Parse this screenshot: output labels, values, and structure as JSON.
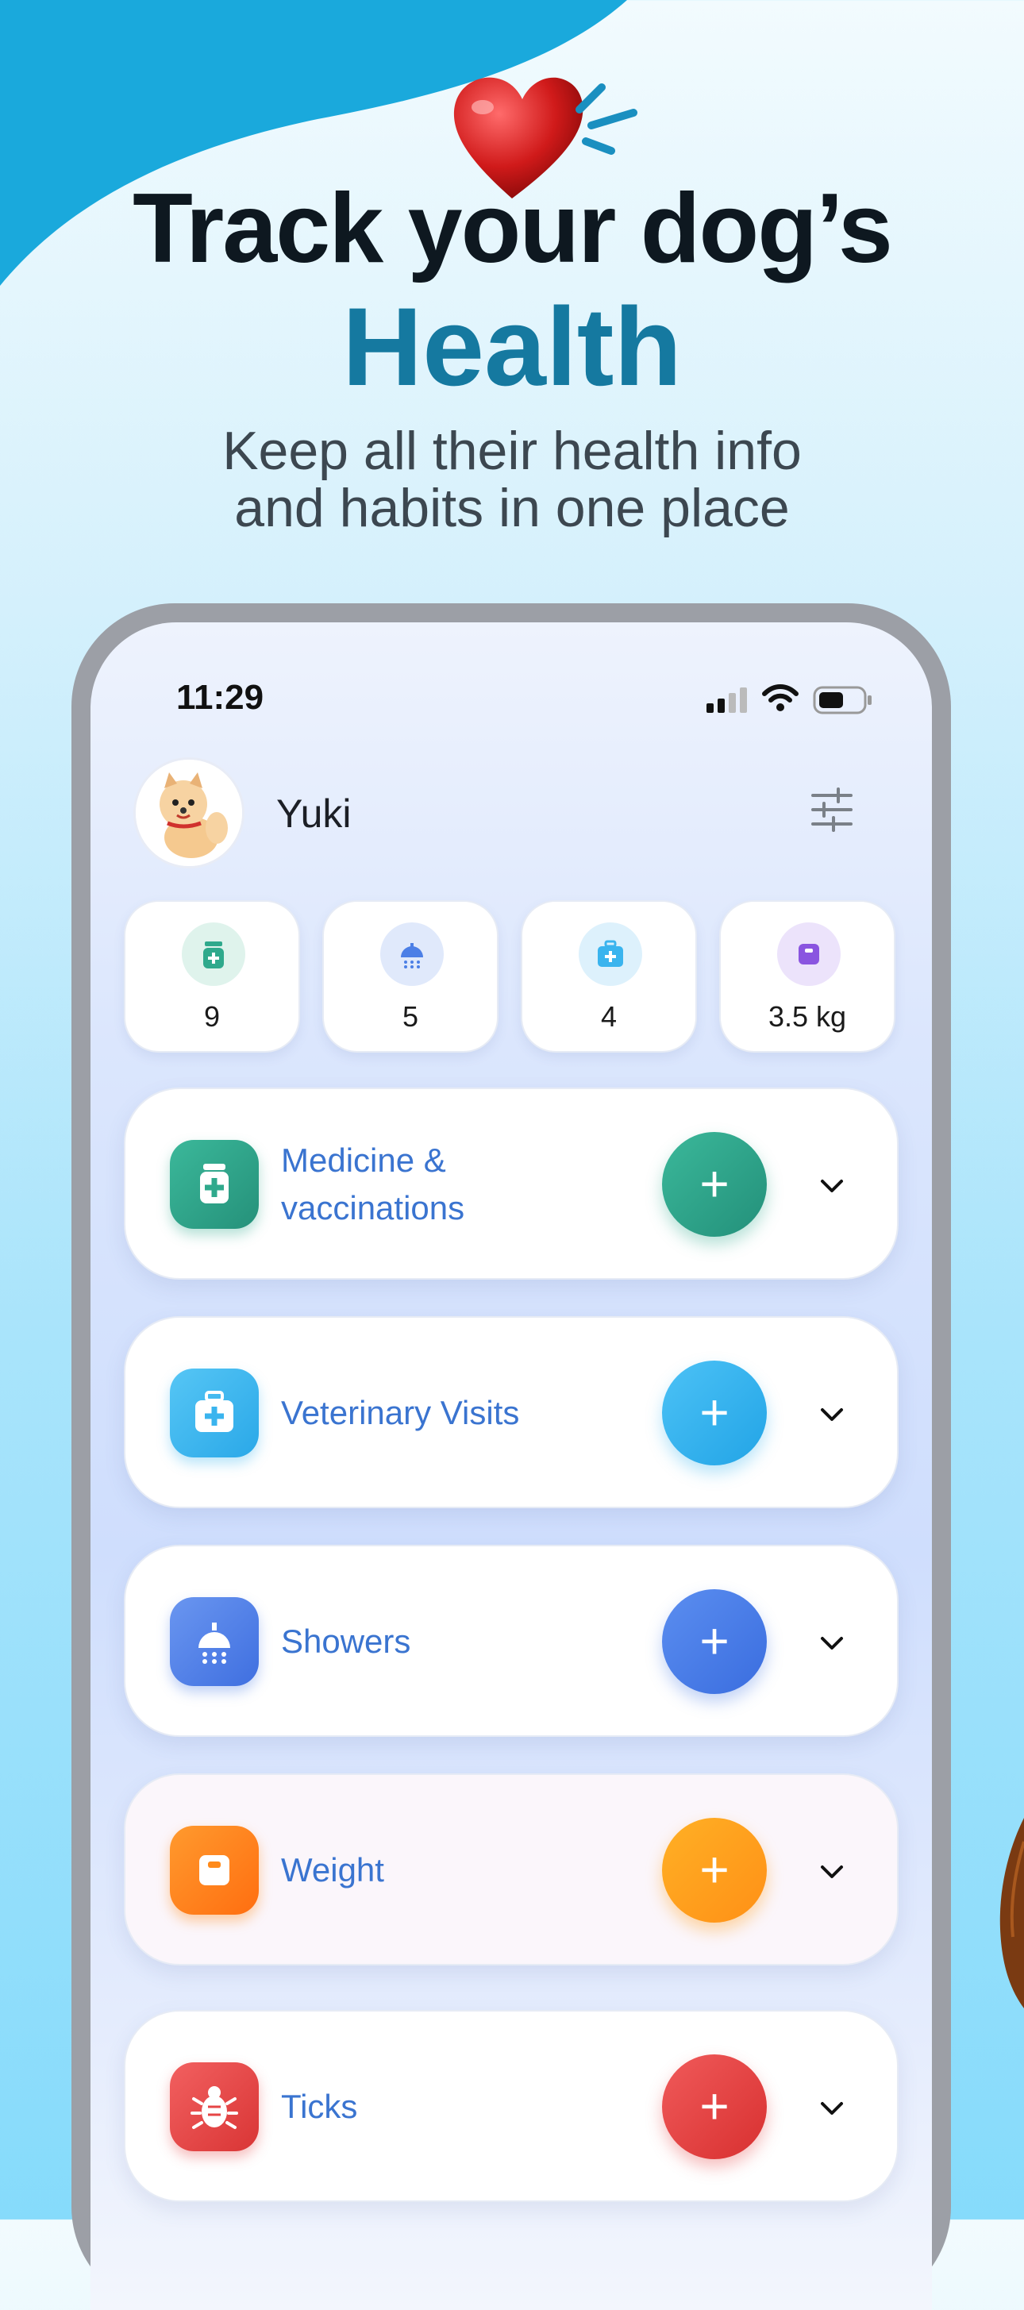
{
  "headline": {
    "line1": "Track your dog’s",
    "line2": "Health",
    "subtitle_line1": "Keep all their health info",
    "subtitle_line2": "and habits in one place"
  },
  "status_bar": {
    "time": "11:29"
  },
  "profile": {
    "pet_name": "Yuki",
    "avatar_icon": "pomeranian-avatar",
    "settings_icon": "sliders-icon"
  },
  "stats": [
    {
      "icon": "medicine-bottle-icon",
      "value": "9",
      "color": "#2fa98c"
    },
    {
      "icon": "shower-icon",
      "value": "5",
      "color": "#4c7fe6"
    },
    {
      "icon": "vet-kit-icon",
      "value": "4",
      "color": "#3ab4ee"
    },
    {
      "icon": "scale-icon",
      "value": "3.5 kg",
      "color": "#8a55e0"
    }
  ],
  "categories": [
    {
      "line1": "Medicine &",
      "line2": "vaccinations",
      "icon": "medicine-bottle-icon",
      "color": "#2fa98c"
    },
    {
      "line1": "Veterinary Visits",
      "icon": "vet-kit-icon",
      "color": "#3ab4ee"
    },
    {
      "line1": "Showers",
      "icon": "shower-icon",
      "color": "#4c7fe6"
    },
    {
      "line1": "Weight",
      "icon": "scale-icon",
      "color": "#ff8a1a"
    },
    {
      "line1": "Ticks",
      "icon": "tick-bug-icon",
      "color": "#e64545"
    }
  ],
  "add_label": "+"
}
